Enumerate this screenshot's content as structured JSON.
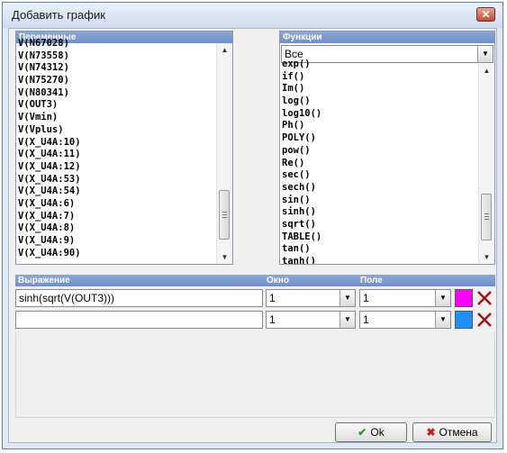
{
  "window": {
    "title": "Добавить график",
    "close_symbol": "✕"
  },
  "variables": {
    "header": "Переменные",
    "items": [
      "V(N67028)",
      "V(N73558)",
      "V(N74312)",
      "V(N75270)",
      "V(N80341)",
      "V(OUT3)",
      "V(Vmin)",
      "V(Vplus)",
      "V(X_U4A:10)",
      "V(X_U4A:11)",
      "V(X_U4A:12)",
      "V(X_U4A:53)",
      "V(X_U4A:54)",
      "V(X_U4A:6)",
      "V(X_U4A:7)",
      "V(X_U4A:8)",
      "V(X_U4A:9)",
      "V(X_U4A:90)"
    ]
  },
  "functions": {
    "header": "Функции",
    "filter_value": "Все",
    "items": [
      "exp()",
      "if()",
      "Im()",
      "log()",
      "log10()",
      "Ph()",
      "POLY()",
      "pow()",
      "Re()",
      "sec()",
      "sech()",
      "sin()",
      "sinh()",
      "sqrt()",
      "TABLE()",
      "tan()",
      "tanh()"
    ]
  },
  "expressions": {
    "header_expr": "Выражение",
    "header_window": "Окно",
    "header_field": "Поле",
    "rows": [
      {
        "expr": "sinh(sqrt(V(OUT3)))",
        "window": "1",
        "field": "1",
        "color": "#ff00ff"
      },
      {
        "expr": "",
        "window": "1",
        "field": "1",
        "color": "#1e90ff"
      }
    ]
  },
  "buttons": {
    "ok": "Ok",
    "cancel": "Отмена"
  },
  "icons": {
    "scroll_up": "▲",
    "scroll_down": "▼",
    "dropdown": "▼",
    "ok_check": "✔",
    "cancel_x": "✖"
  }
}
